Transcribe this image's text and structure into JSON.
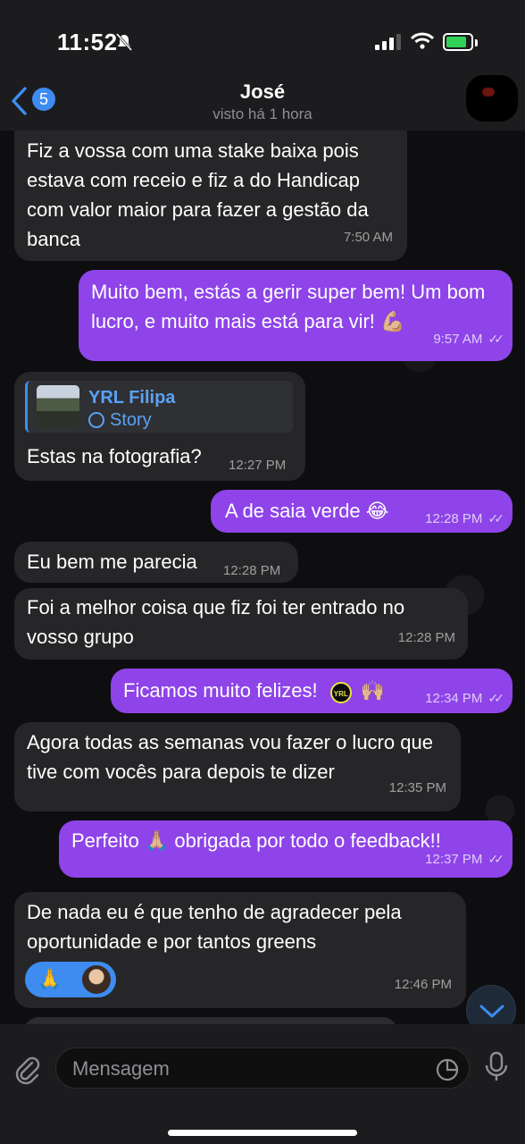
{
  "status_bar": {
    "time": "11:52"
  },
  "header": {
    "back_count": "5",
    "name": "José",
    "subtitle": "visto há 1 hora"
  },
  "messages": [
    {
      "text": "Fiz a vossa com uma stake baixa pois estava com receio e fiz a do Handicap com valor maior para fazer a gestão da banca",
      "time": "7:50 AM"
    },
    {
      "text": "Muito bem, estás a gerir super bem! Um bom lucro, e muito mais está para vir! 💪🏼",
      "time": "9:57 AM"
    },
    {
      "reply_name": "YRL Filipa",
      "reply_kind": "Story",
      "text": "Estas na fotografia?",
      "time": "12:27 PM"
    },
    {
      "text": "A de saia verde 😂",
      "time": "12:28 PM"
    },
    {
      "text": "Eu bem me parecia",
      "time": "12:28 PM"
    },
    {
      "text": "Foi a melhor coisa que fiz foi ter entrado no vosso grupo",
      "time": "12:28 PM"
    },
    {
      "text": "Ficamos muito felizes!",
      "badge": "YRL",
      "emoji": "🙌🏼",
      "time": "12:34 PM"
    },
    {
      "text": "Agora todas as semanas vou fazer o lucro que tive com vocês para depois te dizer",
      "time": "12:35 PM"
    },
    {
      "text": "Perfeito 🙏🏼 obrigada por todo o feedback!!",
      "time": "12:37 PM"
    },
    {
      "text": "De nada eu é que tenho de agradecer pela oportunidade e por tantos greens",
      "reaction": "🙏",
      "time": "12:46 PM"
    }
  ],
  "input": {
    "placeholder": "Mensagem"
  },
  "colors": {
    "outgoing": "#8e44e8",
    "incoming": "#262628",
    "accent": "#3e8cf0"
  }
}
